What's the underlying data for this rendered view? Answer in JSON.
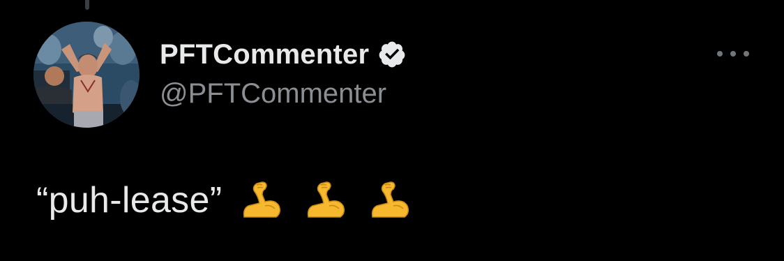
{
  "tweet": {
    "display_name": "PFTCommenter",
    "handle": "@PFTCommenter",
    "verified": true,
    "text": "“puh-lease”",
    "emojis": [
      "flexed-biceps-icon",
      "flexed-biceps-icon",
      "flexed-biceps-icon"
    ]
  },
  "colors": {
    "background": "#000000",
    "primary_text": "#e7e9ea",
    "secondary_text": "#8b8f94",
    "emoji_gold": "#f5b82e"
  }
}
